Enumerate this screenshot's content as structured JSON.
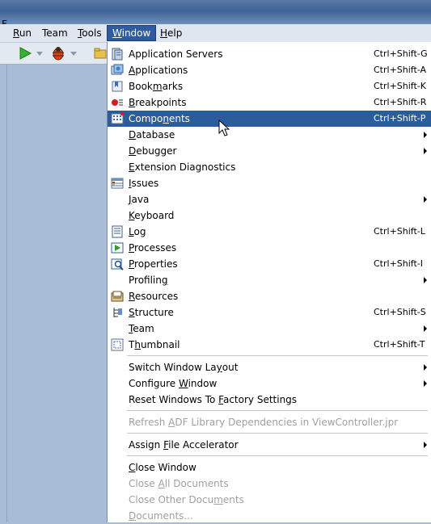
{
  "menubar": {
    "items": [
      {
        "label": "Run",
        "mnemonic": "R",
        "rest": "un"
      },
      {
        "label": "Team",
        "mnemonic": "",
        "rest": "Team"
      },
      {
        "label": "Tools",
        "mnemonic": "T",
        "rest": "ools"
      },
      {
        "label": "Window",
        "mnemonic": "W",
        "rest": "indow"
      },
      {
        "label": "Help",
        "mnemonic": "H",
        "rest": "elp"
      }
    ],
    "active": "Window"
  },
  "title_fragment": "F",
  "window_menu": {
    "items": [
      {
        "pre": "",
        "mn": "",
        "post": "Application Servers",
        "shortcut": "Ctrl+Shift-G",
        "icon": "servers-icon"
      },
      {
        "pre": "",
        "mn": "A",
        "post": "pplications",
        "shortcut": "Ctrl+Shift-A",
        "icon": "applications-icon"
      },
      {
        "pre": "Book",
        "mn": "m",
        "post": "arks",
        "shortcut": "Ctrl+Shift-K",
        "icon": "bookmarks-icon"
      },
      {
        "pre": "",
        "mn": "B",
        "post": "reakpoints",
        "shortcut": "Ctrl+Shift-R",
        "icon": "breakpoints-icon"
      },
      {
        "pre": "Compo",
        "mn": "n",
        "post": "ents",
        "shortcut": "Ctrl+Shift-P",
        "icon": "components-icon",
        "selected": true
      },
      {
        "pre": "",
        "mn": "D",
        "post": "atabase",
        "submenu": true
      },
      {
        "pre": "",
        "mn": "D",
        "post": "ebugger",
        "submenu": true
      },
      {
        "pre": "",
        "mn": "E",
        "post": "xtension Diagnostics"
      },
      {
        "pre": "",
        "mn": "I",
        "post": "ssues",
        "icon": "issues-icon"
      },
      {
        "pre": "",
        "mn": "J",
        "post": "ava",
        "submenu": true
      },
      {
        "pre": "",
        "mn": "K",
        "post": "eyboard"
      },
      {
        "pre": "",
        "mn": "L",
        "post": "og",
        "shortcut": "Ctrl+Shift-L",
        "icon": "log-icon"
      },
      {
        "pre": "",
        "mn": "P",
        "post": "rocesses",
        "icon": "processes-icon"
      },
      {
        "pre": "",
        "mn": "P",
        "post": "roperties",
        "shortcut": "Ctrl+Shift-I",
        "icon": "properties-icon"
      },
      {
        "pre": "Profilin",
        "mn": "g",
        "post": "",
        "submenu": true
      },
      {
        "pre": "",
        "mn": "R",
        "post": "esources",
        "icon": "resources-icon"
      },
      {
        "pre": "",
        "mn": "S",
        "post": "tructure",
        "shortcut": "Ctrl+Shift-S",
        "icon": "structure-icon"
      },
      {
        "pre": "",
        "mn": "T",
        "post": "eam",
        "submenu": true
      },
      {
        "pre": "T",
        "mn": "h",
        "post": "umbnail",
        "shortcut": "Ctrl+Shift-T",
        "icon": "thumbnail-icon"
      },
      {
        "separator": true
      },
      {
        "pre": "Switch Window La",
        "mn": "y",
        "post": "out",
        "submenu": true
      },
      {
        "pre": "Configure ",
        "mn": "W",
        "post": "indow",
        "submenu": true
      },
      {
        "pre": "Reset Windows To ",
        "mn": "F",
        "post": "actory Settings"
      },
      {
        "separator": true
      },
      {
        "pre": "Refresh ",
        "mn": "A",
        "post": "DF Library Dependencies in ViewController.jpr",
        "disabled": true
      },
      {
        "separator": true
      },
      {
        "pre": "Assign ",
        "mn": "F",
        "post": "ile Accelerator",
        "submenu": true
      },
      {
        "separator": true
      },
      {
        "pre": "",
        "mn": "C",
        "post": "lose Window"
      },
      {
        "pre": "Close ",
        "mn": "A",
        "post": "ll Documents",
        "disabled": true
      },
      {
        "pre": "Close Other Docu",
        "mn": "m",
        "post": "ents",
        "disabled": true
      },
      {
        "pre": "",
        "mn": "D",
        "post": "ocuments...",
        "disabled": true
      }
    ]
  },
  "colors": {
    "menu_highlight": "#2c5d9b",
    "workspace": "#a9bcd6",
    "disabled_text": "#a0a0a0"
  }
}
